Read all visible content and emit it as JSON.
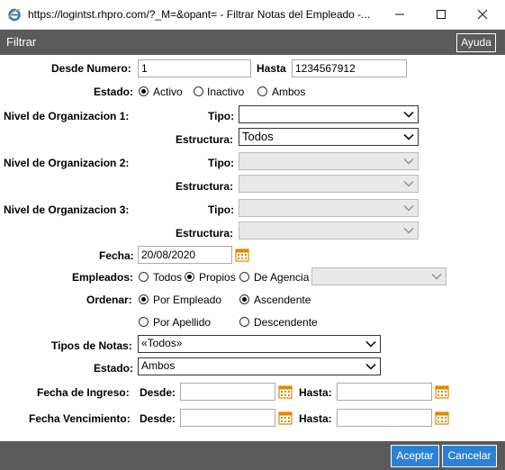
{
  "window": {
    "title": "https://logintst.rhpro.com/?_M=&opant= - Filtrar Notas del Empleado -..."
  },
  "header": {
    "title": "Filtrar",
    "help_label": "Ayuda"
  },
  "desde_numero": {
    "label": "Desde Numero:",
    "value": "1"
  },
  "hasta_numero": {
    "label": "Hasta",
    "value": "1234567912"
  },
  "estado1": {
    "label": "Estado:",
    "options": [
      "Activo",
      "Inactivo",
      "Ambos"
    ],
    "selected": "Activo"
  },
  "org1": {
    "label": "Nivel de Organizacion 1:",
    "tipo_label": "Tipo:",
    "tipo_value": "",
    "estructura_label": "Estructura:",
    "estructura_value": "Todos"
  },
  "org2": {
    "label": "Nivel de Organizacion 2:",
    "tipo_label": "Tipo:",
    "estructura_label": "Estructura:"
  },
  "org3": {
    "label": "Nivel de Organizacion 3:",
    "tipo_label": "Tipo:",
    "estructura_label": "Estructura:"
  },
  "fecha": {
    "label": "Fecha:",
    "value": "20/08/2020"
  },
  "empleados": {
    "label": "Empleados:",
    "options": [
      "Todos",
      "Propios",
      "De Agencia"
    ],
    "selected": "Propios",
    "agencia_value": ""
  },
  "ordenar": {
    "label": "Ordenar:",
    "options": [
      "Por Empleado",
      "Por Apellido"
    ],
    "selected": "Por Empleado",
    "dir_options": [
      "Ascendente",
      "Descendente"
    ],
    "dir_selected": "Ascendente"
  },
  "tipos_notas": {
    "label": "Tipos de Notas:",
    "value": "«Todos»"
  },
  "estado2": {
    "label": "Estado:",
    "value": "Ambos"
  },
  "fecha_ingreso": {
    "label": "Fecha de Ingreso:",
    "desde_label": "Desde:",
    "hasta_label": "Hasta:",
    "desde_value": "",
    "hasta_value": ""
  },
  "fecha_venc": {
    "label": "Fecha Vencimiento:",
    "desde_label": "Desde:",
    "hasta_label": "Hasta:",
    "desde_value": "",
    "hasta_value": ""
  },
  "footer": {
    "accept_label": "Aceptar",
    "cancel_label": "Cancelar"
  },
  "colors": {
    "header_bg": "#5a5a5a",
    "button_blue": "#2a82d6"
  }
}
